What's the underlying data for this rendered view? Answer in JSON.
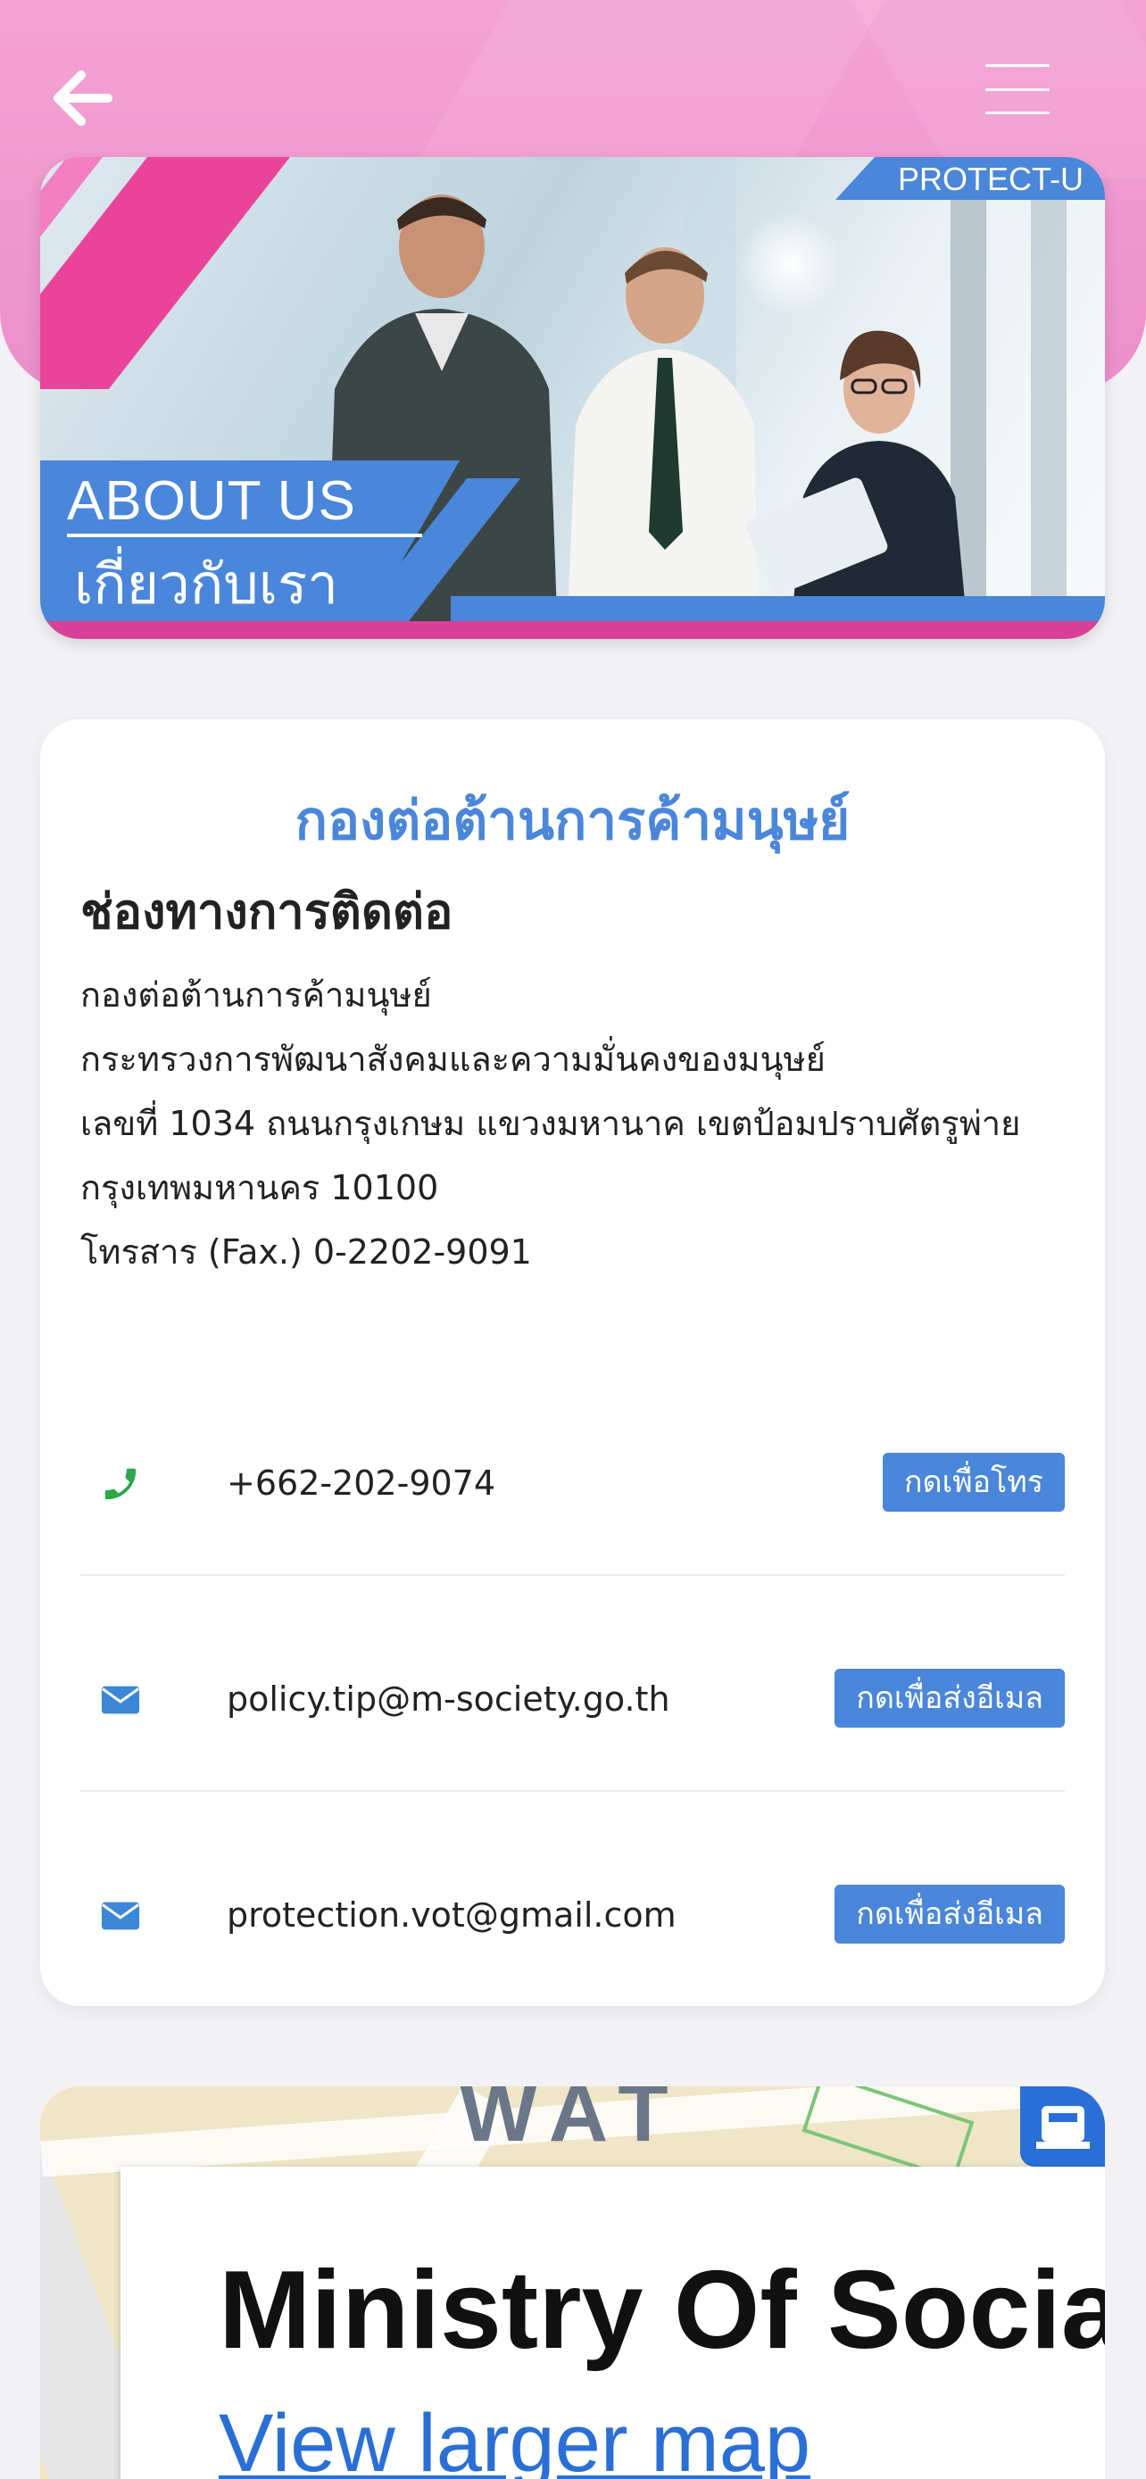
{
  "header": {
    "back_icon": "arrow-left-icon",
    "menu_icon": "hamburger-menu-icon"
  },
  "banner": {
    "tag": "PROTECT-U",
    "about_en": "ABOUT US",
    "about_th": "เกี่ยวกับเรา"
  },
  "contact": {
    "org_title": "กองต่อต้านการค้ามนุษย์",
    "section_title": "ช่องทางการติดต่อ",
    "address_lines": [
      "กองต่อต้านการค้ามนุษย์",
      "กระทรวงการพัฒนาสังคมและความมั่นคงของมนุษย์",
      "เลขที่ 1034 ถนนกรุงเกษม แขวงมหานาค เขตป้อมปราบศัตรูพ่าย",
      "กรุงเทพมหานคร 10100",
      "โทรสาร (Fax.) 0-2202-9091"
    ],
    "items": [
      {
        "icon": "phone-icon",
        "text": "+662-202-9074",
        "button": "กดเพื่อโทร"
      },
      {
        "icon": "envelope-icon",
        "text": "policy.tip@m-society.go.th",
        "button": "กดเพื่อส่งอีเมล"
      },
      {
        "icon": "envelope-icon",
        "text": "protection.vot@gmail.com",
        "button": "กดเพื่อส่งอีเมล"
      }
    ]
  },
  "map": {
    "area_label": "WAT",
    "title": "Ministry Of Social",
    "link": "View larger map"
  },
  "colors": {
    "accent_blue": "#4a86d9",
    "header_pink": "#ec8fca",
    "phone_green": "#2aa84a",
    "mail_blue": "#3b86d6"
  }
}
